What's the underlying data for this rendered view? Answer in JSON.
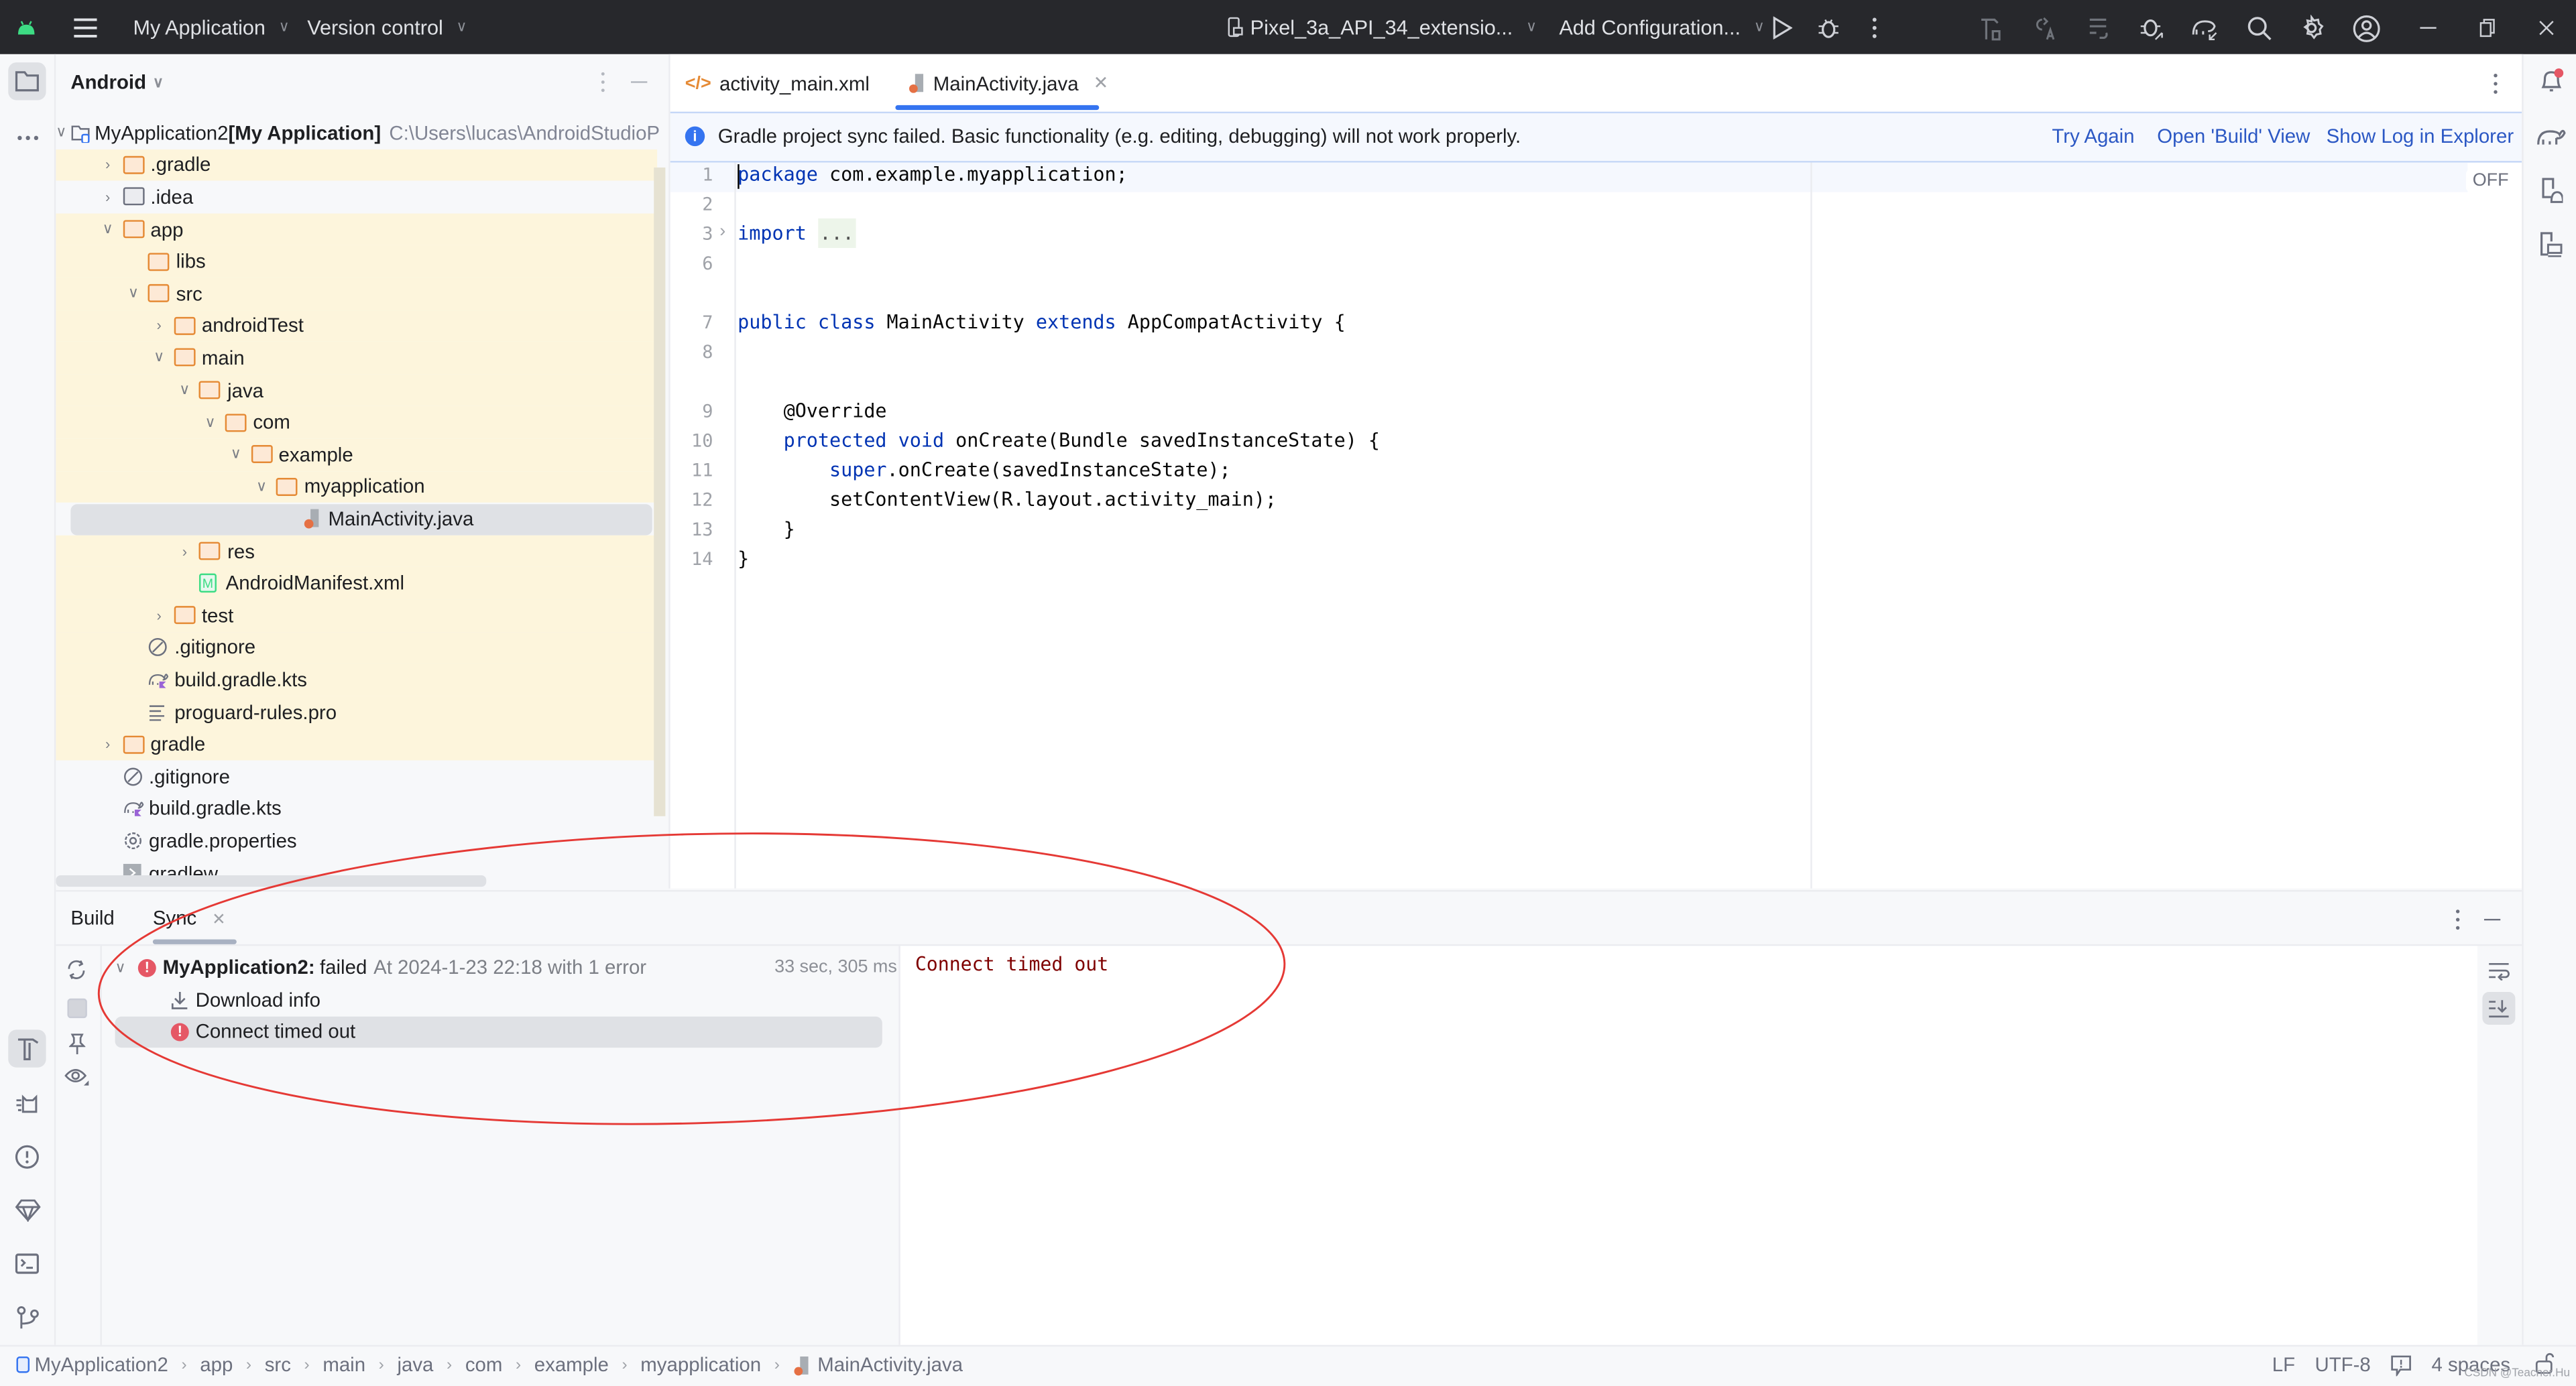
{
  "titlebar": {
    "project_menu": "My Application",
    "vcs_menu": "Version control",
    "device_selector": "Pixel_3a_API_34_extensio...",
    "run_config": "Add Configuration...",
    "icons": [
      "android-logo-icon",
      "hamburger-menu-icon",
      "device-icon",
      "run-icon",
      "debug-icon",
      "more-vert-icon",
      "build-icon",
      "apply-changes-icon",
      "apply-code-changes-icon",
      "attach-debugger-icon",
      "gradle-sync-icon",
      "search-icon",
      "settings-icon",
      "account-icon",
      "minimize-icon",
      "restore-icon",
      "close-icon"
    ]
  },
  "project_panel": {
    "view_selector": "Android",
    "root": {
      "name": "MyApplication2",
      "module": "[My Application]",
      "path": "C:\\Users\\lucas\\AndroidStudioP"
    },
    "items": [
      {
        "label": ".gradle",
        "depth": 1,
        "type": "folder",
        "expanded": false,
        "highlight": true
      },
      {
        "label": ".idea",
        "depth": 1,
        "type": "folder-gray",
        "expanded": false,
        "highlight": false
      },
      {
        "label": "app",
        "depth": 1,
        "type": "folder",
        "expanded": true,
        "highlight": true
      },
      {
        "label": "libs",
        "depth": 2,
        "type": "folder",
        "expanded": null,
        "highlight": true
      },
      {
        "label": "src",
        "depth": 2,
        "type": "folder",
        "expanded": true,
        "highlight": true
      },
      {
        "label": "androidTest",
        "depth": 3,
        "type": "folder",
        "expanded": false,
        "highlight": true
      },
      {
        "label": "main",
        "depth": 3,
        "type": "folder",
        "expanded": true,
        "highlight": true
      },
      {
        "label": "java",
        "depth": 4,
        "type": "folder",
        "expanded": true,
        "highlight": true
      },
      {
        "label": "com",
        "depth": 5,
        "type": "folder",
        "expanded": true,
        "highlight": true
      },
      {
        "label": "example",
        "depth": 6,
        "type": "folder",
        "expanded": true,
        "highlight": true
      },
      {
        "label": "myapplication",
        "depth": 7,
        "type": "folder",
        "expanded": true,
        "highlight": true
      },
      {
        "label": "MainActivity.java",
        "depth": 8,
        "type": "java",
        "expanded": null,
        "highlight": true,
        "selected": true
      },
      {
        "label": "res",
        "depth": 4,
        "type": "folder",
        "expanded": false,
        "highlight": true
      },
      {
        "label": "AndroidManifest.xml",
        "depth": 4,
        "type": "manifest",
        "expanded": null,
        "highlight": true
      },
      {
        "label": "test",
        "depth": 3,
        "type": "folder",
        "expanded": false,
        "highlight": true
      },
      {
        "label": ".gitignore",
        "depth": 2,
        "type": "ignore",
        "expanded": null,
        "highlight": true
      },
      {
        "label": "build.gradle.kts",
        "depth": 2,
        "type": "gradle",
        "expanded": null,
        "highlight": true
      },
      {
        "label": "proguard-rules.pro",
        "depth": 2,
        "type": "text",
        "expanded": null,
        "highlight": true
      },
      {
        "label": "gradle",
        "depth": 1,
        "type": "folder",
        "expanded": false,
        "highlight": true
      },
      {
        "label": ".gitignore",
        "depth": 1,
        "type": "ignore",
        "expanded": null,
        "highlight": false
      },
      {
        "label": "build.gradle.kts",
        "depth": 1,
        "type": "gradle",
        "expanded": null,
        "highlight": false
      },
      {
        "label": "gradle.properties",
        "depth": 1,
        "type": "settings",
        "expanded": null,
        "highlight": false
      },
      {
        "label": "gradlew",
        "depth": 1,
        "type": "exec",
        "expanded": null,
        "highlight": false
      }
    ]
  },
  "editor": {
    "tabs": [
      {
        "label": "activity_main.xml",
        "icon": "xml-icon",
        "active": false
      },
      {
        "label": "MainActivity.java",
        "icon": "java-file-icon",
        "active": true,
        "closable": true
      }
    ],
    "banner": {
      "message": "Gradle project sync failed. Basic functionality (e.g. editing, debugging) will not work properly.",
      "actions": [
        "Try Again",
        "Open 'Build' View",
        "Show Log in Explorer"
      ]
    },
    "inlay_toggle": "OFF",
    "lines": [
      {
        "n": "1",
        "tokens": [
          {
            "t": "package",
            "k": "kw"
          },
          {
            "t": " com.example.myapplication;",
            "k": ""
          }
        ]
      },
      {
        "n": "2",
        "tokens": []
      },
      {
        "n": "3",
        "tokens": [
          {
            "t": "import",
            "k": "kw"
          },
          {
            "t": " ",
            "k": ""
          },
          {
            "t": "...",
            "k": "fold"
          }
        ],
        "foldable": true
      },
      {
        "n": "6",
        "tokens": []
      },
      {
        "n": "7",
        "tokens": [
          {
            "t": "public class",
            "k": "kw"
          },
          {
            "t": " MainActivity ",
            "k": ""
          },
          {
            "t": "extends",
            "k": "kw"
          },
          {
            "t": " AppCompatActivity {",
            "k": ""
          }
        ]
      },
      {
        "n": "8",
        "tokens": []
      },
      {
        "n": "9",
        "tokens": [
          {
            "t": "    @Override",
            "k": ""
          }
        ]
      },
      {
        "n": "10",
        "tokens": [
          {
            "t": "    ",
            "k": ""
          },
          {
            "t": "protected void",
            "k": "kw"
          },
          {
            "t": " onCreate(Bundle savedInstanceState) {",
            "k": ""
          }
        ]
      },
      {
        "n": "11",
        "tokens": [
          {
            "t": "        ",
            "k": ""
          },
          {
            "t": "super",
            "k": "kw"
          },
          {
            "t": ".onCreate(savedInstanceState);",
            "k": ""
          }
        ]
      },
      {
        "n": "12",
        "tokens": [
          {
            "t": "        setContentView(R.layout.activity_main);",
            "k": ""
          }
        ]
      },
      {
        "n": "13",
        "tokens": [
          {
            "t": "    }",
            "k": ""
          }
        ]
      },
      {
        "n": "14",
        "tokens": [
          {
            "t": "}",
            "k": ""
          }
        ]
      }
    ]
  },
  "build_panel": {
    "tabs": [
      {
        "label": "Build",
        "active": false
      },
      {
        "label": "Sync",
        "active": true,
        "closable": true
      }
    ],
    "tree": {
      "root_name": "MyApplication2:",
      "root_status": "failed",
      "root_detail": "At 2024-1-23 22:18 with 1 error",
      "duration": "33 sec, 305 ms",
      "children": [
        {
          "label": "Download info",
          "icon": "download-icon"
        },
        {
          "label": "Connect timed out",
          "icon": "error-icon",
          "selected": true
        }
      ]
    },
    "console_output": "Connect timed out"
  },
  "statusbar": {
    "breadcrumbs": [
      "MyApplication2",
      "app",
      "src",
      "main",
      "java",
      "com",
      "example",
      "myapplication",
      "MainActivity.java"
    ],
    "line_separator": "LF",
    "encoding": "UTF-8",
    "indent": "4 spaces",
    "watermark": "CSDN @Teacher.Hu"
  },
  "colors": {
    "titlebar_bg": "#27282c",
    "accent": "#3574f0",
    "error": "#e55765",
    "link": "#2c58c4",
    "keyword": "#0033b3",
    "console_error": "#7f0000",
    "annotation_circle": "#e53935",
    "highlight_module": "#fdf5dc"
  }
}
